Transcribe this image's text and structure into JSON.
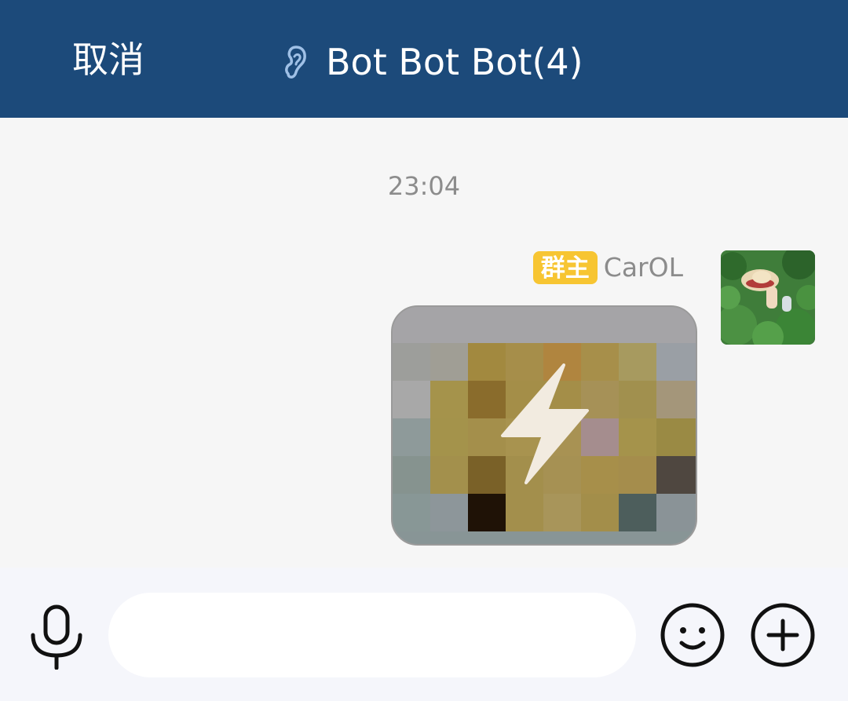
{
  "header": {
    "cancel_label": "取消",
    "title": "Bot Bot Bot(4)",
    "icons": {
      "mode": "ear-icon"
    },
    "background": "#1c4a7a"
  },
  "chat": {
    "timestamp": "23:04",
    "messages": [
      {
        "sender_role": "群主",
        "sender_name": "CarOL",
        "type": "image",
        "icon": "lightning-bolt-icon",
        "avatar_icon": "avatar-image"
      }
    ],
    "badge_color": "#f7c532"
  },
  "input_bar": {
    "input_value": "",
    "placeholder": "",
    "icons": {
      "voice": "microphone-icon",
      "emoji": "smiley-icon",
      "more": "plus-circle-icon"
    }
  }
}
